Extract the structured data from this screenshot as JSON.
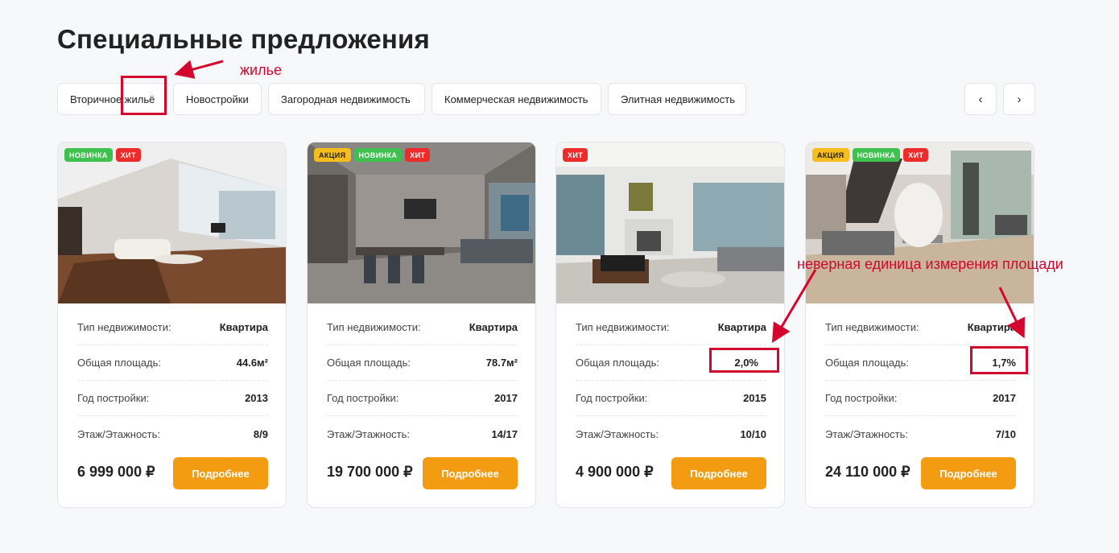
{
  "page": {
    "title": "Специальные предложения"
  },
  "tabs": [
    {
      "label": "Вторичное жильё"
    },
    {
      "label": "Новостройки"
    },
    {
      "label": "Загородная недвижимость"
    },
    {
      "label": "Коммерческая недвижимость"
    },
    {
      "label": "Элитная недвижимость"
    }
  ],
  "nav": {
    "prev": "‹",
    "next": "›"
  },
  "labels": {
    "type": "Тип недвижимости:",
    "area": "Общая площадь:",
    "year": "Год постройки:",
    "floor": "Этаж/Этажность:",
    "more": "Подробнее"
  },
  "cards": [
    {
      "badges": [
        "НОВИНКА",
        "ХИТ"
      ],
      "type": "Квартира",
      "area": "44.6м²",
      "year": "2013",
      "floor": "8/9",
      "price": "6 999 000 ₽"
    },
    {
      "badges": [
        "АКЦИЯ",
        "НОВИНКА",
        "ХИТ"
      ],
      "type": "Квартира",
      "area": "78.7м²",
      "year": "2017",
      "floor": "14/17",
      "price": "19 700 000 ₽"
    },
    {
      "badges": [
        "ХИТ"
      ],
      "type": "Квартира",
      "area": "2,0%",
      "year": "2015",
      "floor": "10/10",
      "price": "4 900 000 ₽"
    },
    {
      "badges": [
        "АКЦИЯ",
        "НОВИНКА",
        "ХИТ"
      ],
      "type": "Квартира",
      "area": "1,7%",
      "year": "2017",
      "floor": "7/10",
      "price": "24 110 000 ₽"
    }
  ],
  "annotations": {
    "tab_note": "жилье",
    "area_note": "неверная единица измерения площади"
  },
  "colors": {
    "accent": "#f39c11",
    "annotation": "#d3072e",
    "badge_new": "#3ec14e",
    "badge_hit": "#ee2b2b",
    "badge_sale": "#f7bd1b"
  }
}
